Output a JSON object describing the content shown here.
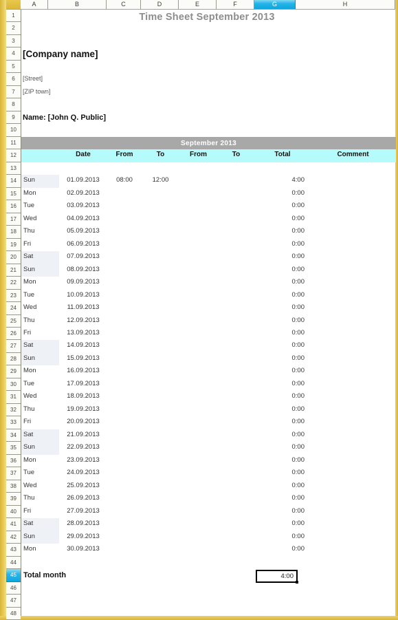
{
  "window": {
    "accent_frame_color": "#e3bf3e",
    "selected_header_color": "#23b4e8",
    "band_month_color": "#a8a8a8",
    "band_header_color": "#b6fbfb"
  },
  "columns": [
    {
      "label": "A",
      "selected": false
    },
    {
      "label": "B",
      "selected": false
    },
    {
      "label": "C",
      "selected": false
    },
    {
      "label": "D",
      "selected": false
    },
    {
      "label": "E",
      "selected": false
    },
    {
      "label": "F",
      "selected": false
    },
    {
      "label": "G",
      "selected": true
    },
    {
      "label": "H",
      "selected": false
    }
  ],
  "row_numbers": [
    "1",
    "2",
    "3",
    "4",
    "5",
    "6",
    "7",
    "8",
    "9",
    "10",
    "11",
    "12",
    "13",
    "14",
    "15",
    "16",
    "17",
    "18",
    "19",
    "20",
    "21",
    "22",
    "23",
    "24",
    "25",
    "26",
    "27",
    "28",
    "29",
    "30",
    "31",
    "32",
    "33",
    "34",
    "35",
    "36",
    "37",
    "38",
    "39",
    "40",
    "41",
    "42",
    "43",
    "44",
    "45",
    "46",
    "47",
    "48"
  ],
  "selected_row_number": "45",
  "document": {
    "title": "Time Sheet September 2013",
    "company": "[Company name]",
    "street": "[Street]",
    "zip_town": "[ZIP town]",
    "name_line": "Name: [John Q. Public]",
    "month_band": "September 2013",
    "watermark": ""
  },
  "table": {
    "headers": [
      "Date",
      "From",
      "To",
      "From",
      "To",
      "Total",
      "Comment"
    ],
    "rows": [
      {
        "day": "Sun",
        "date": "01.09.2013",
        "from1": "08:00",
        "to1": "12:00",
        "from2": "",
        "to2": "",
        "total": "4:00",
        "comment": "",
        "weekend": true
      },
      {
        "day": "Mon",
        "date": "02.09.2013",
        "from1": "",
        "to1": "",
        "from2": "",
        "to2": "",
        "total": "0:00",
        "comment": "",
        "weekend": false
      },
      {
        "day": "Tue",
        "date": "03.09.2013",
        "from1": "",
        "to1": "",
        "from2": "",
        "to2": "",
        "total": "0:00",
        "comment": "",
        "weekend": false
      },
      {
        "day": "Wed",
        "date": "04.09.2013",
        "from1": "",
        "to1": "",
        "from2": "",
        "to2": "",
        "total": "0:00",
        "comment": "",
        "weekend": false
      },
      {
        "day": "Thu",
        "date": "05.09.2013",
        "from1": "",
        "to1": "",
        "from2": "",
        "to2": "",
        "total": "0:00",
        "comment": "",
        "weekend": false
      },
      {
        "day": "Fri",
        "date": "06.09.2013",
        "from1": "",
        "to1": "",
        "from2": "",
        "to2": "",
        "total": "0:00",
        "comment": "",
        "weekend": false
      },
      {
        "day": "Sat",
        "date": "07.09.2013",
        "from1": "",
        "to1": "",
        "from2": "",
        "to2": "",
        "total": "0:00",
        "comment": "",
        "weekend": true
      },
      {
        "day": "Sun",
        "date": "08.09.2013",
        "from1": "",
        "to1": "",
        "from2": "",
        "to2": "",
        "total": "0:00",
        "comment": "",
        "weekend": true
      },
      {
        "day": "Mon",
        "date": "09.09.2013",
        "from1": "",
        "to1": "",
        "from2": "",
        "to2": "",
        "total": "0:00",
        "comment": "",
        "weekend": false
      },
      {
        "day": "Tue",
        "date": "10.09.2013",
        "from1": "",
        "to1": "",
        "from2": "",
        "to2": "",
        "total": "0:00",
        "comment": "",
        "weekend": false
      },
      {
        "day": "Wed",
        "date": "11.09.2013",
        "from1": "",
        "to1": "",
        "from2": "",
        "to2": "",
        "total": "0:00",
        "comment": "",
        "weekend": false
      },
      {
        "day": "Thu",
        "date": "12.09.2013",
        "from1": "",
        "to1": "",
        "from2": "",
        "to2": "",
        "total": "0:00",
        "comment": "",
        "weekend": false
      },
      {
        "day": "Fri",
        "date": "13.09.2013",
        "from1": "",
        "to1": "",
        "from2": "",
        "to2": "",
        "total": "0:00",
        "comment": "",
        "weekend": false
      },
      {
        "day": "Sat",
        "date": "14.09.2013",
        "from1": "",
        "to1": "",
        "from2": "",
        "to2": "",
        "total": "0:00",
        "comment": "",
        "weekend": true
      },
      {
        "day": "Sun",
        "date": "15.09.2013",
        "from1": "",
        "to1": "",
        "from2": "",
        "to2": "",
        "total": "0:00",
        "comment": "",
        "weekend": true
      },
      {
        "day": "Mon",
        "date": "16.09.2013",
        "from1": "",
        "to1": "",
        "from2": "",
        "to2": "",
        "total": "0:00",
        "comment": "",
        "weekend": false
      },
      {
        "day": "Tue",
        "date": "17.09.2013",
        "from1": "",
        "to1": "",
        "from2": "",
        "to2": "",
        "total": "0:00",
        "comment": "",
        "weekend": false
      },
      {
        "day": "Wed",
        "date": "18.09.2013",
        "from1": "",
        "to1": "",
        "from2": "",
        "to2": "",
        "total": "0:00",
        "comment": "",
        "weekend": false
      },
      {
        "day": "Thu",
        "date": "19.09.2013",
        "from1": "",
        "to1": "",
        "from2": "",
        "to2": "",
        "total": "0:00",
        "comment": "",
        "weekend": false
      },
      {
        "day": "Fri",
        "date": "20.09.2013",
        "from1": "",
        "to1": "",
        "from2": "",
        "to2": "",
        "total": "0:00",
        "comment": "",
        "weekend": false
      },
      {
        "day": "Sat",
        "date": "21.09.2013",
        "from1": "",
        "to1": "",
        "from2": "",
        "to2": "",
        "total": "0:00",
        "comment": "",
        "weekend": true
      },
      {
        "day": "Sun",
        "date": "22.09.2013",
        "from1": "",
        "to1": "",
        "from2": "",
        "to2": "",
        "total": "0:00",
        "comment": "",
        "weekend": true
      },
      {
        "day": "Mon",
        "date": "23.09.2013",
        "from1": "",
        "to1": "",
        "from2": "",
        "to2": "",
        "total": "0:00",
        "comment": "",
        "weekend": false
      },
      {
        "day": "Tue",
        "date": "24.09.2013",
        "from1": "",
        "to1": "",
        "from2": "",
        "to2": "",
        "total": "0:00",
        "comment": "",
        "weekend": false
      },
      {
        "day": "Wed",
        "date": "25.09.2013",
        "from1": "",
        "to1": "",
        "from2": "",
        "to2": "",
        "total": "0:00",
        "comment": "",
        "weekend": false
      },
      {
        "day": "Thu",
        "date": "26.09.2013",
        "from1": "",
        "to1": "",
        "from2": "",
        "to2": "",
        "total": "0:00",
        "comment": "",
        "weekend": false
      },
      {
        "day": "Fri",
        "date": "27.09.2013",
        "from1": "",
        "to1": "",
        "from2": "",
        "to2": "",
        "total": "0:00",
        "comment": "",
        "weekend": false
      },
      {
        "day": "Sat",
        "date": "28.09.2013",
        "from1": "",
        "to1": "",
        "from2": "",
        "to2": "",
        "total": "0:00",
        "comment": "",
        "weekend": true
      },
      {
        "day": "Sun",
        "date": "29.09.2013",
        "from1": "",
        "to1": "",
        "from2": "",
        "to2": "",
        "total": "0:00",
        "comment": "",
        "weekend": true
      },
      {
        "day": "Mon",
        "date": "30.09.2013",
        "from1": "",
        "to1": "",
        "from2": "",
        "to2": "",
        "total": "0:00",
        "comment": "",
        "weekend": false
      }
    ],
    "total_month_label": "Total month",
    "total_month_value": "4:00"
  }
}
